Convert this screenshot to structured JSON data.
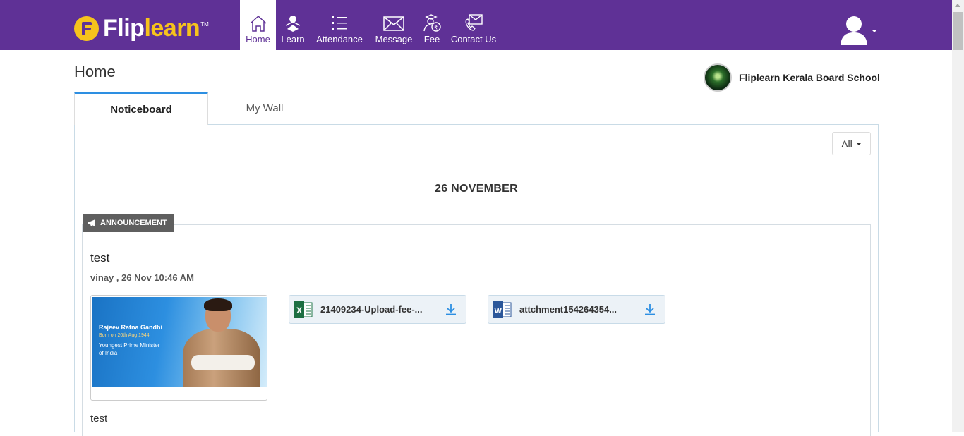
{
  "brand": {
    "logo_white": "Flip",
    "logo_yellow": "learn",
    "trademark": "TM"
  },
  "nav": {
    "items": [
      {
        "label": "Home",
        "icon": "home-icon",
        "active": true
      },
      {
        "label": "Learn",
        "icon": "learn-icon"
      },
      {
        "label": "Attendance",
        "icon": "attendance-icon"
      },
      {
        "label": "Message",
        "icon": "message-icon"
      },
      {
        "label": "Fee",
        "icon": "fee-icon"
      },
      {
        "label": "Contact Us",
        "icon": "contact-icon"
      }
    ]
  },
  "page": {
    "title": "Home"
  },
  "school": {
    "name": "Fliplearn Kerala Board School"
  },
  "tabs": [
    {
      "label": "Noticeboard",
      "active": true
    },
    {
      "label": "My Wall"
    }
  ],
  "filter": {
    "selected": "All"
  },
  "feed": {
    "date": "26 NOVEMBER",
    "post": {
      "tag": "ANNOUNCEMENT",
      "title": "test",
      "meta": "vinay , 26 Nov 10:46 AM",
      "image": {
        "name": "Rajeev Ratna Gandhi",
        "born": "Born on 20th Aug 1944",
        "caption_line1": "Youngest Prime Minister",
        "caption_line2": "of India"
      },
      "attachments": [
        {
          "name": "21409234-Upload-fee-...",
          "type": "excel"
        },
        {
          "name": "attchment154264354...",
          "type": "word"
        }
      ],
      "body": "test"
    }
  },
  "colors": {
    "brand_purple": "#5f3196",
    "brand_yellow": "#f6c31c",
    "tab_accent": "#2d8fe2",
    "download_blue": "#2d8fe2"
  }
}
